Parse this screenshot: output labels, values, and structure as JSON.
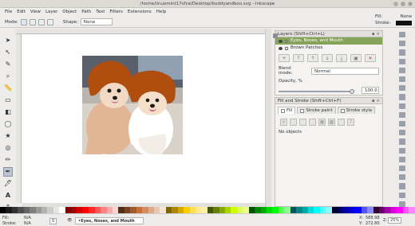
{
  "window": {
    "title": "/home/linuxmint17sfce/Desktop/buddyandboo.svg - Inkscape"
  },
  "menu": [
    "File",
    "Edit",
    "View",
    "Layer",
    "Object",
    "Path",
    "Text",
    "Filters",
    "Extensions",
    "Help"
  ],
  "tool_controls": {
    "mode_label": "Mode:",
    "shape_label": "Shape:",
    "shape_value": "None"
  },
  "fill_stroke_indicator": {
    "fill_label": "Fill:",
    "fill_value": "None",
    "stroke_label": "Stroke:"
  },
  "layers_panel": {
    "title": "Layers (Shift+Ctrl+L)",
    "layers": [
      {
        "name": "Eyes, Noses, and Mouth",
        "selected": true
      },
      {
        "name": "Brown Patches",
        "selected": false
      }
    ],
    "blend_label": "Blend mode:",
    "blend_value": "Normal",
    "opacity_label": "Opacity, %",
    "opacity_value": "100.0",
    "opacity": 1.0
  },
  "fill_stroke_panel": {
    "title": "Fill and Stroke (Shift+Ctrl+F)",
    "tabs": [
      "Fill",
      "Stroke paint",
      "Stroke style"
    ],
    "status": "No objects"
  },
  "statusbar": {
    "fill_label": "Fill:",
    "fill_value": "N/A",
    "stroke_label": "Stroke:",
    "stroke_value": "N/A",
    "opacity_value": "0",
    "layer_value": "•Eyes, Noses, and Mouth",
    "x_label": "X:",
    "x_value": "588.98",
    "y_label": "Y:",
    "y_value": "272.80",
    "z_label": "Z:",
    "zoom_value": "25%"
  },
  "colors": {
    "selected_layer": "#86a35a",
    "canvas": "#ffffff",
    "fur": "#b5520f",
    "skin": "#e8b89a"
  }
}
